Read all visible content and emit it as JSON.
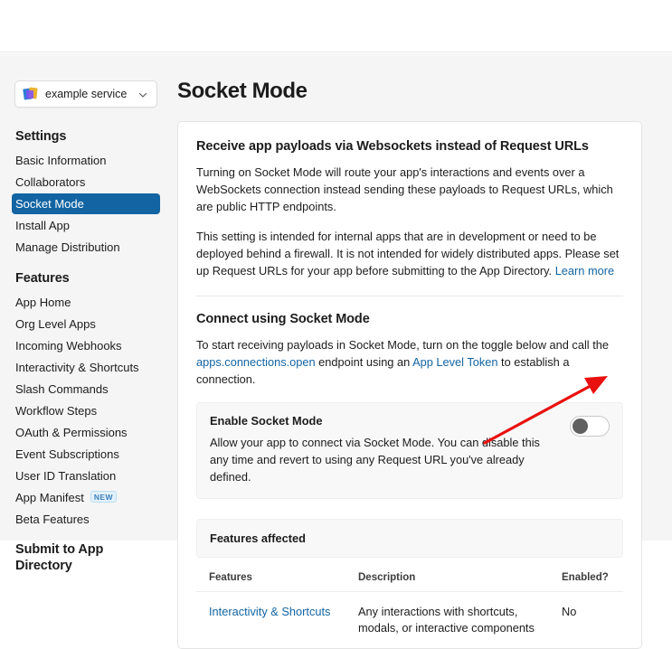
{
  "window": {
    "topbar_empty": ""
  },
  "sidebar": {
    "app_switcher": {
      "name": "example service",
      "icon": "app-logo-icon",
      "chevron": "chevron-down-icon"
    },
    "groups": [
      {
        "heading": "Settings",
        "items": [
          {
            "label": "Basic Information",
            "active": false
          },
          {
            "label": "Collaborators",
            "active": false
          },
          {
            "label": "Socket Mode",
            "active": true
          },
          {
            "label": "Install App",
            "active": false
          },
          {
            "label": "Manage Distribution",
            "active": false
          }
        ]
      },
      {
        "heading": "Features",
        "items": [
          {
            "label": "App Home",
            "active": false
          },
          {
            "label": "Org Level Apps",
            "active": false
          },
          {
            "label": "Incoming Webhooks",
            "active": false
          },
          {
            "label": "Interactivity & Shortcuts",
            "active": false
          },
          {
            "label": "Slash Commands",
            "active": false
          },
          {
            "label": "Workflow Steps",
            "active": false
          },
          {
            "label": "OAuth & Permissions",
            "active": false
          },
          {
            "label": "Event Subscriptions",
            "active": false
          },
          {
            "label": "User ID Translation",
            "active": false
          },
          {
            "label": "App Manifest",
            "active": false,
            "badge": "NEW"
          },
          {
            "label": "Beta Features",
            "active": false
          }
        ]
      },
      {
        "heading": "Submit to App Directory",
        "items": []
      }
    ]
  },
  "main": {
    "page_title": "Socket Mode",
    "section_websockets": {
      "title": "Receive app payloads via Websockets instead of Request URLs",
      "paragraph_1": "Turning on Socket Mode will route your app's interactions and events over a WebSockets connection instead sending these payloads to Request URLs, which are public HTTP endpoints.",
      "paragraph_2_a": "This setting is intended for internal apps that are in development or need to be deployed behind a firewall. It is not intended for widely distributed apps. Please set up Request URLs for your app before submitting to the App Directory. ",
      "learn_more_link": "Learn more"
    },
    "section_connect": {
      "title": "Connect using Socket Mode",
      "intro_a": "To start receiving payloads in Socket Mode, turn on the toggle below and call the ",
      "link_apps_connections_open": "apps.connections.open",
      "intro_b": " endpoint using an ",
      "link_app_level_token": "App Level Token",
      "intro_c": " to establish a connection."
    },
    "toggle": {
      "label": "Enable Socket Mode",
      "description": "Allow your app to connect via Socket Mode. You can disable this any time and revert to using any Request URL you've already defined.",
      "state": "off"
    },
    "features_affected": {
      "title": "Features affected",
      "columns": [
        "Features",
        "Description",
        "Enabled?"
      ],
      "rows": [
        {
          "feature": "Interactivity & Shortcuts",
          "description": "Any interactions with shortcuts, modals, or interactive components",
          "enabled": "No"
        }
      ]
    }
  },
  "annotation": {
    "arrow": "red-arrow-pointer",
    "color": "#e8110f",
    "points_to": "enable-socket-mode-toggle"
  },
  "colors": {
    "accent_blue": "#1264a3",
    "page_bg": "#f5f5f5",
    "card_bg": "#ffffff",
    "toggle_knob": "#616061",
    "badge_new_bg": "#e3f1fb",
    "annotation_red": "#e8110f"
  }
}
